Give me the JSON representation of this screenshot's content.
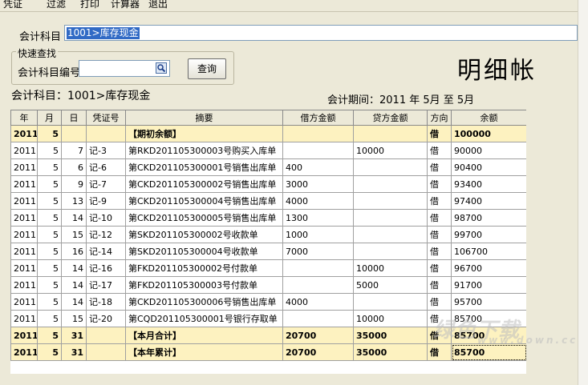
{
  "menu": [
    "凭证",
    "过滤",
    "打印",
    "计算器",
    "退出"
  ],
  "account": {
    "label": "会计科目",
    "value": "1001>库存现金"
  },
  "quick_search": {
    "title": "快速查找",
    "code_label": "会计科目编号",
    "code_value": "",
    "query_label": "查询"
  },
  "title": "明细帐",
  "subject_line": "会计科目：1001>库存现金",
  "period": "会计期间：2011 年 5月 至 5月",
  "columns": [
    "年",
    "月",
    "日",
    "凭证号",
    "摘要",
    "借方金额",
    "贷方金额",
    "方向",
    "余额"
  ],
  "rows": [
    [
      "2011",
      "5",
      "",
      "",
      "【期初余额】",
      "",
      "",
      "借",
      "100000"
    ],
    [
      "2011",
      "5",
      "7",
      "记-3",
      "第RKD201105300003号购买入库单",
      "",
      "10000",
      "借",
      "90000"
    ],
    [
      "2011",
      "5",
      "6",
      "记-6",
      "第CKD201105300001号销售出库单",
      "400",
      "",
      "借",
      "90400"
    ],
    [
      "2011",
      "5",
      "9",
      "记-7",
      "第CKD201105300002号销售出库单",
      "3000",
      "",
      "借",
      "93400"
    ],
    [
      "2011",
      "5",
      "13",
      "记-9",
      "第CKD201105300004号销售出库单",
      "4000",
      "",
      "借",
      "97400"
    ],
    [
      "2011",
      "5",
      "14",
      "记-10",
      "第CKD201105300005号销售出库单",
      "1300",
      "",
      "借",
      "98700"
    ],
    [
      "2011",
      "5",
      "15",
      "记-12",
      "第SKD201105300002号收款单",
      "1000",
      "",
      "借",
      "99700"
    ],
    [
      "2011",
      "5",
      "16",
      "记-14",
      "第SKD201105300004号收款单",
      "7000",
      "",
      "借",
      "106700"
    ],
    [
      "2011",
      "5",
      "14",
      "记-16",
      "第FKD201105300002号付款单",
      "",
      "10000",
      "借",
      "96700"
    ],
    [
      "2011",
      "5",
      "14",
      "记-17",
      "第FKD201105300003号付款单",
      "",
      "5000",
      "借",
      "91700"
    ],
    [
      "2011",
      "5",
      "14",
      "记-18",
      "第CKD201105300006号销售出库单",
      "4000",
      "",
      "借",
      "95700"
    ],
    [
      "2011",
      "5",
      "15",
      "记-20",
      "第CQD201105300001号银行存取单",
      "",
      "10000",
      "借",
      "85700"
    ],
    [
      "2011",
      "5",
      "31",
      "",
      "【本月合计】",
      "20700",
      "35000",
      "借",
      "85700"
    ],
    [
      "2011",
      "5",
      "31",
      "",
      "【本年累计】",
      "20700",
      "35000",
      "借",
      "85700"
    ]
  ],
  "row_kinds": [
    "sum",
    "",
    "",
    "",
    "",
    "",
    "",
    "",
    "",
    "",
    "",
    "",
    "sum",
    "sum"
  ],
  "watermark": "绿色下载",
  "watermark_sub": "www.down.cc"
}
